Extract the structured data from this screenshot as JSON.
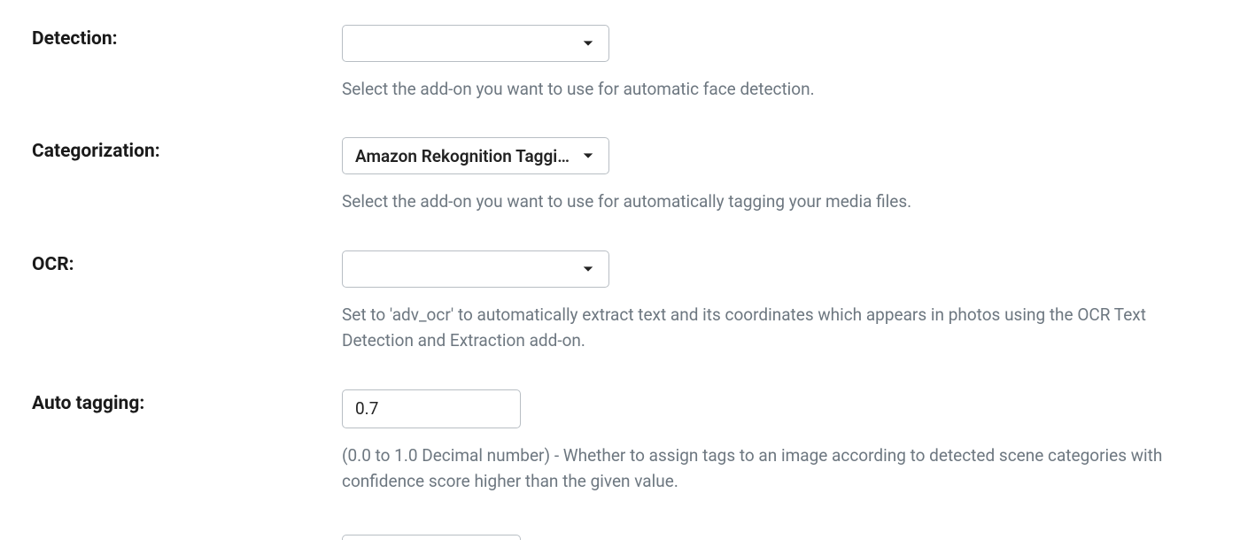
{
  "fields": {
    "detection": {
      "label": "Detection:",
      "value": "",
      "help": "Select the add-on you want to use for automatic face detection."
    },
    "categorization": {
      "label": "Categorization:",
      "value": "Amazon Rekognition Taggi...",
      "help": "Select the add-on you want to use for automatically tagging your media files."
    },
    "ocr": {
      "label": "OCR:",
      "value": "",
      "help": "Set to 'adv_ocr' to automatically extract text and its coordinates which appears in photos using the OCR Text Detection and Extraction add-on."
    },
    "auto_tagging": {
      "label": "Auto tagging:",
      "value": "0.7",
      "help": "(0.0 to 1.0 Decimal number) - Whether to assign tags to an image according to detected scene categories with confidence score higher than the given value."
    }
  }
}
